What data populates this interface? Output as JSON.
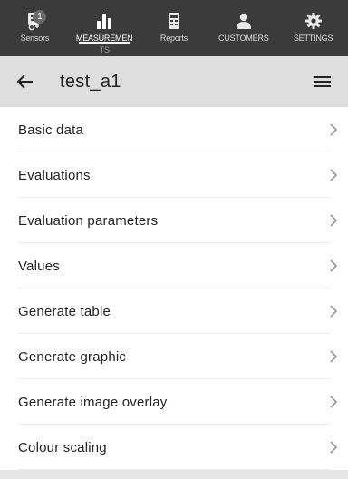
{
  "nav": {
    "tabs": [
      {
        "label": "Sensors",
        "icon": "sensor-icon",
        "badge": "1"
      },
      {
        "label": "MEASUREMENTS",
        "label_visible": "MEASUREMEN",
        "label_overflow": "TS",
        "icon": "bar-chart-icon",
        "active": true
      },
      {
        "label": "Reports",
        "icon": "report-icon"
      },
      {
        "label": "CUSTOMERS",
        "icon": "customer-icon"
      },
      {
        "label": "SETTINGS",
        "icon": "gear-icon"
      }
    ]
  },
  "header": {
    "back_icon": "arrow-left-icon",
    "title": "test_a1",
    "menu_icon": "hamburger-menu-icon"
  },
  "menu": {
    "items": [
      {
        "label": "Basic data"
      },
      {
        "label": "Evaluations"
      },
      {
        "label": "Evaluation parameters"
      },
      {
        "label": "Values"
      },
      {
        "label": "Generate table"
      },
      {
        "label": "Generate graphic"
      },
      {
        "label": "Generate image overlay"
      },
      {
        "label": "Colour scaling"
      }
    ],
    "chevron_icon": "chevron-right-icon"
  },
  "colors": {
    "nav_bg": "#3b3b3b",
    "header_bg": "#dedede",
    "list_bg": "#ffffff",
    "divider": "#ececec"
  }
}
